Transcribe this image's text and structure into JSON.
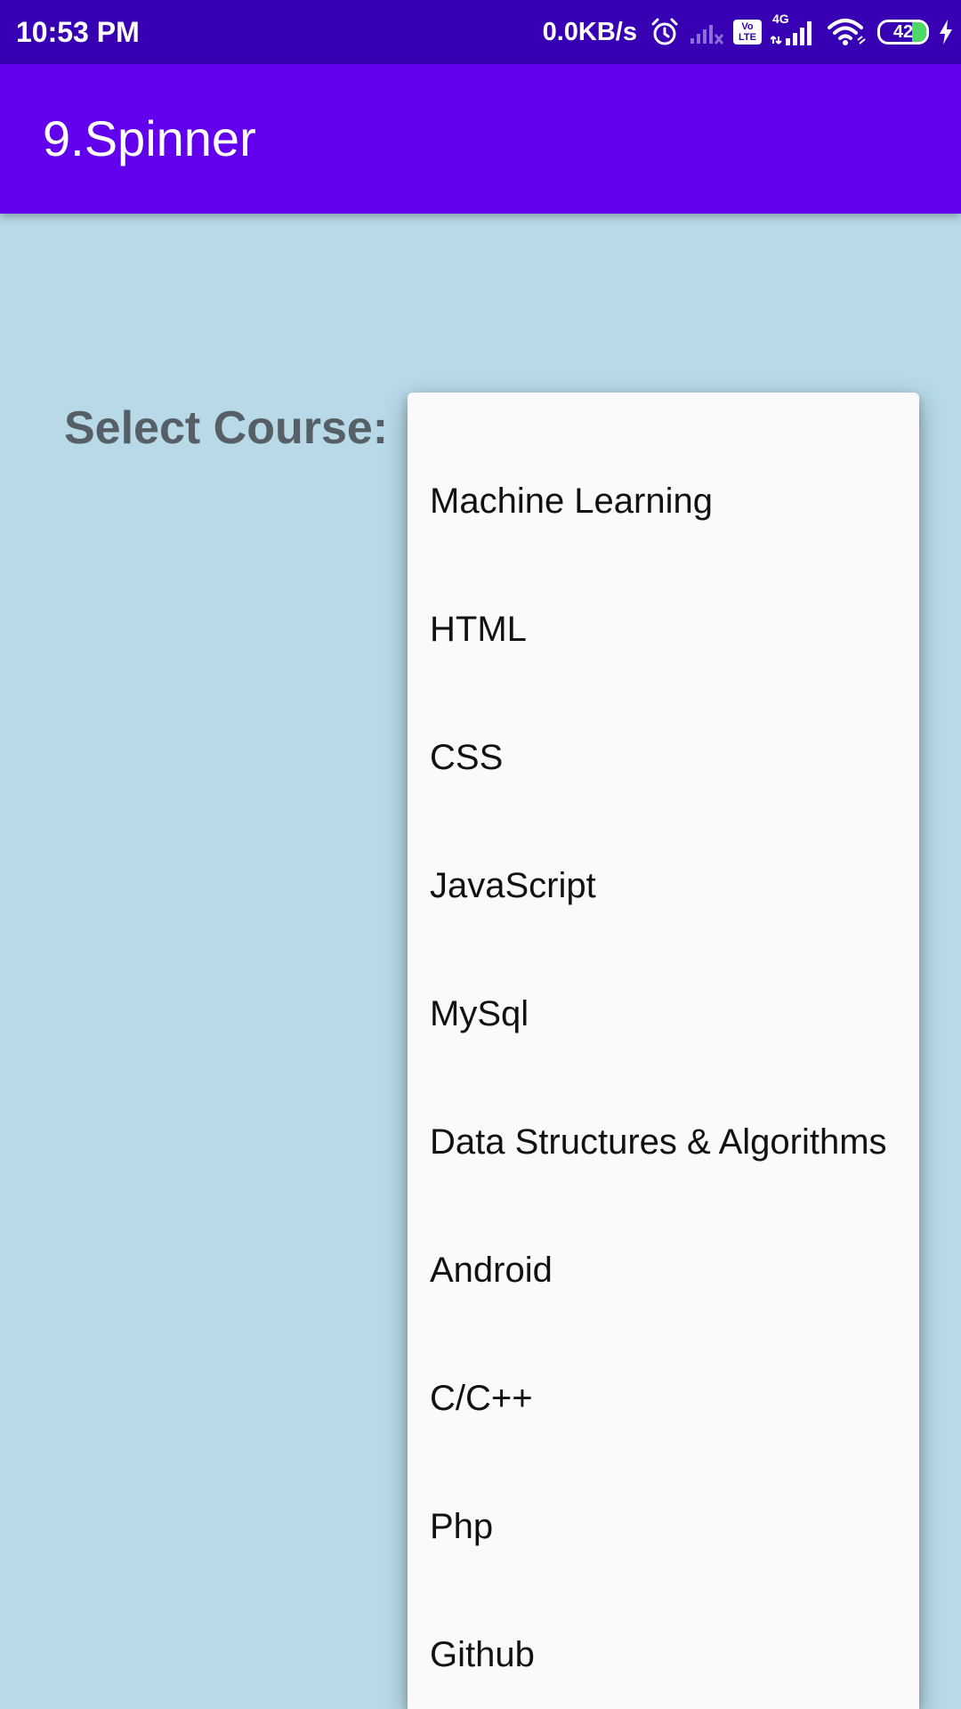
{
  "status_bar": {
    "time": "10:53 PM",
    "net_speed": "0.0KB/s",
    "icons": [
      "alarm-icon",
      "no-signal-icon",
      "volte-icon",
      "4g-signal-icon",
      "wifi-icon",
      "battery-icon",
      "charging-icon"
    ],
    "volte_top": "Vo",
    "volte_bottom": "LTE",
    "network_type": "4G",
    "battery_level": "42"
  },
  "app_bar": {
    "title": "9.Spinner"
  },
  "content": {
    "select_label": "Select Course:"
  },
  "dropdown": {
    "items": [
      "Machine Learning",
      "HTML",
      "CSS",
      "JavaScript",
      "MySql",
      "Data Structures & Algorithms",
      "Android",
      "C/C++",
      "Php",
      "Github"
    ]
  },
  "colors": {
    "status_bar": "#3700b3",
    "app_bar": "#6200ee",
    "background": "#b7d9e8",
    "label": "#555f65",
    "dropdown_bg": "#fafafa"
  }
}
